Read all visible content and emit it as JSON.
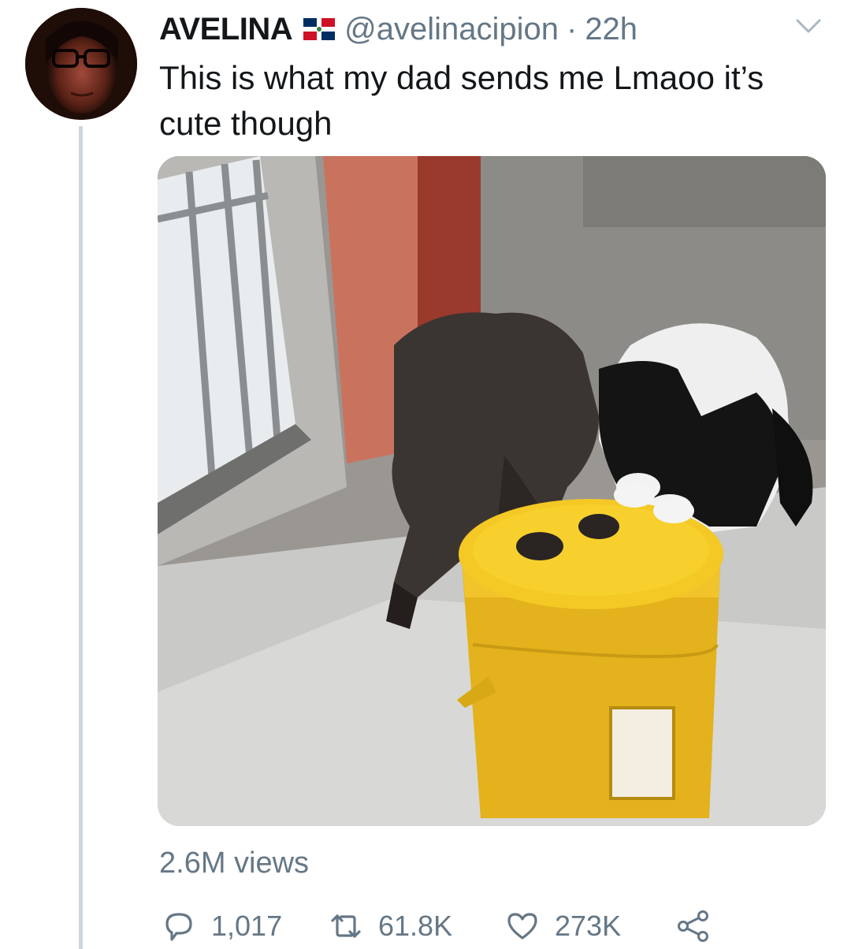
{
  "tweet": {
    "display_name": "AVELINA",
    "flag_icon": "dominican-republic-flag-icon",
    "handle": "@avelinacipion",
    "separator": "·",
    "time": "22h",
    "text": "This is what my dad sends me Lmaoo it’s cute though",
    "views": "2.6M views",
    "actions": {
      "reply_count": "1,017",
      "retweet_count": "61.8K",
      "like_count": "273K"
    },
    "media": {
      "kind": "video",
      "description_icon": "video-thumbnail"
    }
  },
  "icons": {
    "reply": "reply-icon",
    "retweet": "retweet-icon",
    "like": "heart-icon",
    "share": "share-icon",
    "more": "chevron-down-icon"
  },
  "colors": {
    "text": "#14171a",
    "secondary": "#657786",
    "thread_line": "#ccd6dd",
    "flag_blue": "#002d62",
    "flag_red": "#ce1126"
  }
}
